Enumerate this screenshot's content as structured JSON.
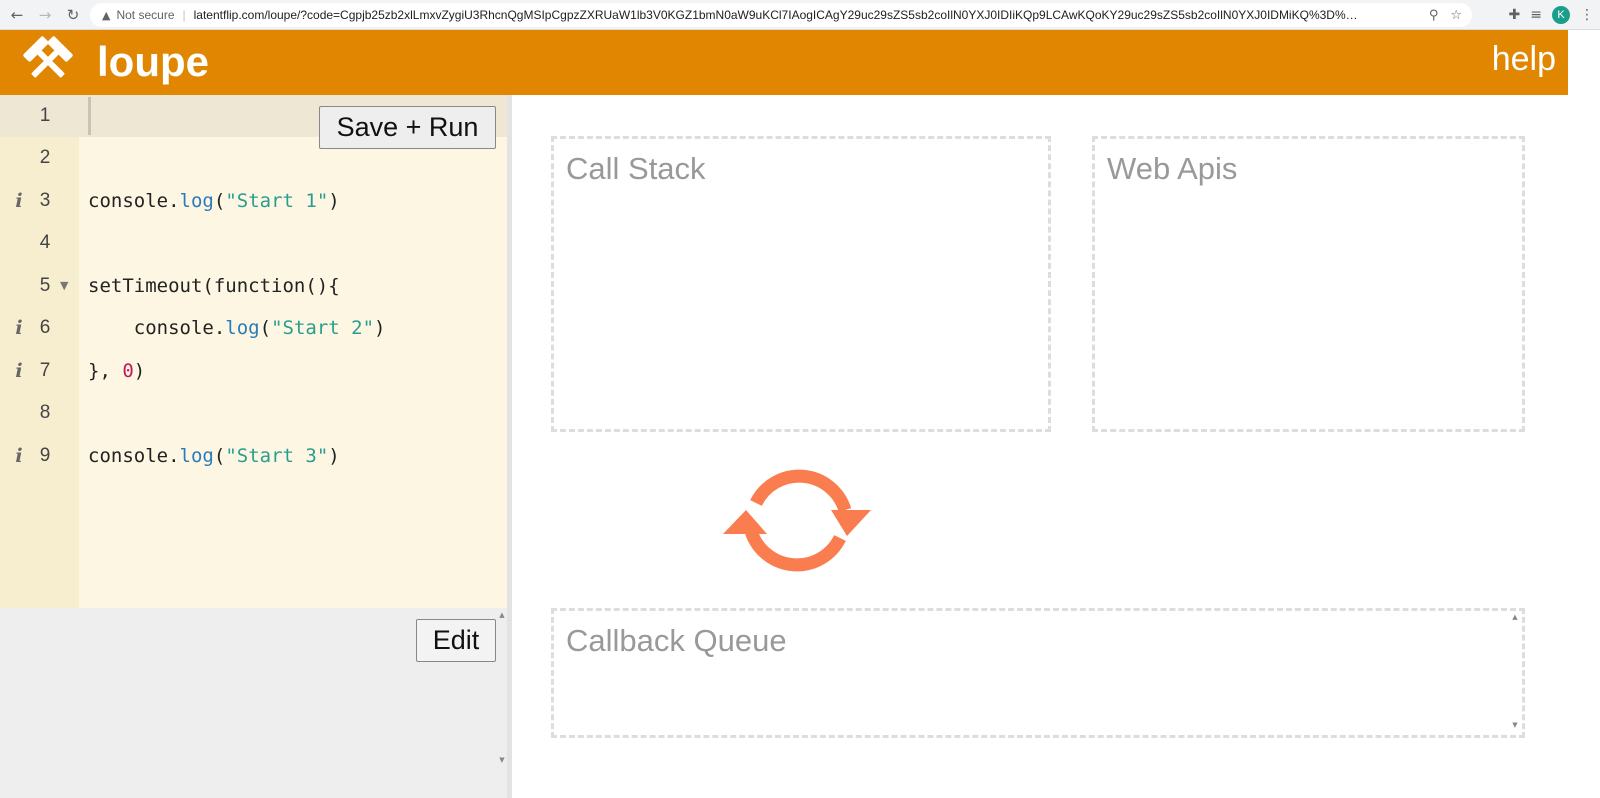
{
  "browser": {
    "security_label": "Not secure",
    "url": "latentflip.com/loupe/?code=Cgpjb25zb2xlLmxvZygiU3RhcnQgMSIpCgpzZXRUaW1lb3V0KGZ1bmN0aW9uKCl7IAogICAgY29uc29sZS5sb2coIlN0YXJ0IDIiKQp9LCAwKQoKY29uc29sZS5sb2coIlN0YXJ0IDMiKQ%3D%3D!!!",
    "profile_initial": "K"
  },
  "header": {
    "title": "loupe",
    "help_label": "help",
    "bg_color": "#e08600"
  },
  "editor": {
    "lines": [
      {
        "number": "1",
        "info": false,
        "fold": false
      },
      {
        "number": "2",
        "info": false,
        "fold": false
      },
      {
        "number": "3",
        "info": true,
        "fold": false
      },
      {
        "number": "4",
        "info": false,
        "fold": false
      },
      {
        "number": "5",
        "info": false,
        "fold": true
      },
      {
        "number": "6",
        "info": true,
        "fold": false
      },
      {
        "number": "7",
        "info": true,
        "fold": false
      },
      {
        "number": "8",
        "info": false,
        "fold": false
      },
      {
        "number": "9",
        "info": true,
        "fold": false
      }
    ],
    "code": {
      "l3": {
        "obj": "console",
        "dot": ".",
        "method": "log",
        "open": "(",
        "str": "\"Start 1\"",
        "close": ")"
      },
      "l5": {
        "fn": "setTimeout(function(){"
      },
      "l6": {
        "indent": "    ",
        "obj": "console",
        "dot": ".",
        "method": "log",
        "open": "(",
        "str": "\"Start 2\"",
        "close": ")"
      },
      "l7": {
        "head": "}, ",
        "num": "0",
        "close": ")"
      },
      "l9": {
        "obj": "console",
        "dot": ".",
        "method": "log",
        "open": "(",
        "str": "\"Start 3\"",
        "close": ")"
      }
    },
    "save_run_label": "Save + Run",
    "edit_label": "Edit"
  },
  "panes": {
    "call_stack": "Call Stack",
    "web_apis": "Web Apis",
    "callback_queue": "Callback Queue"
  },
  "icons": {
    "logo": "hammers-icon",
    "event_loop": "refresh-cycle-icon",
    "event_loop_color": "#fa7d4f"
  }
}
